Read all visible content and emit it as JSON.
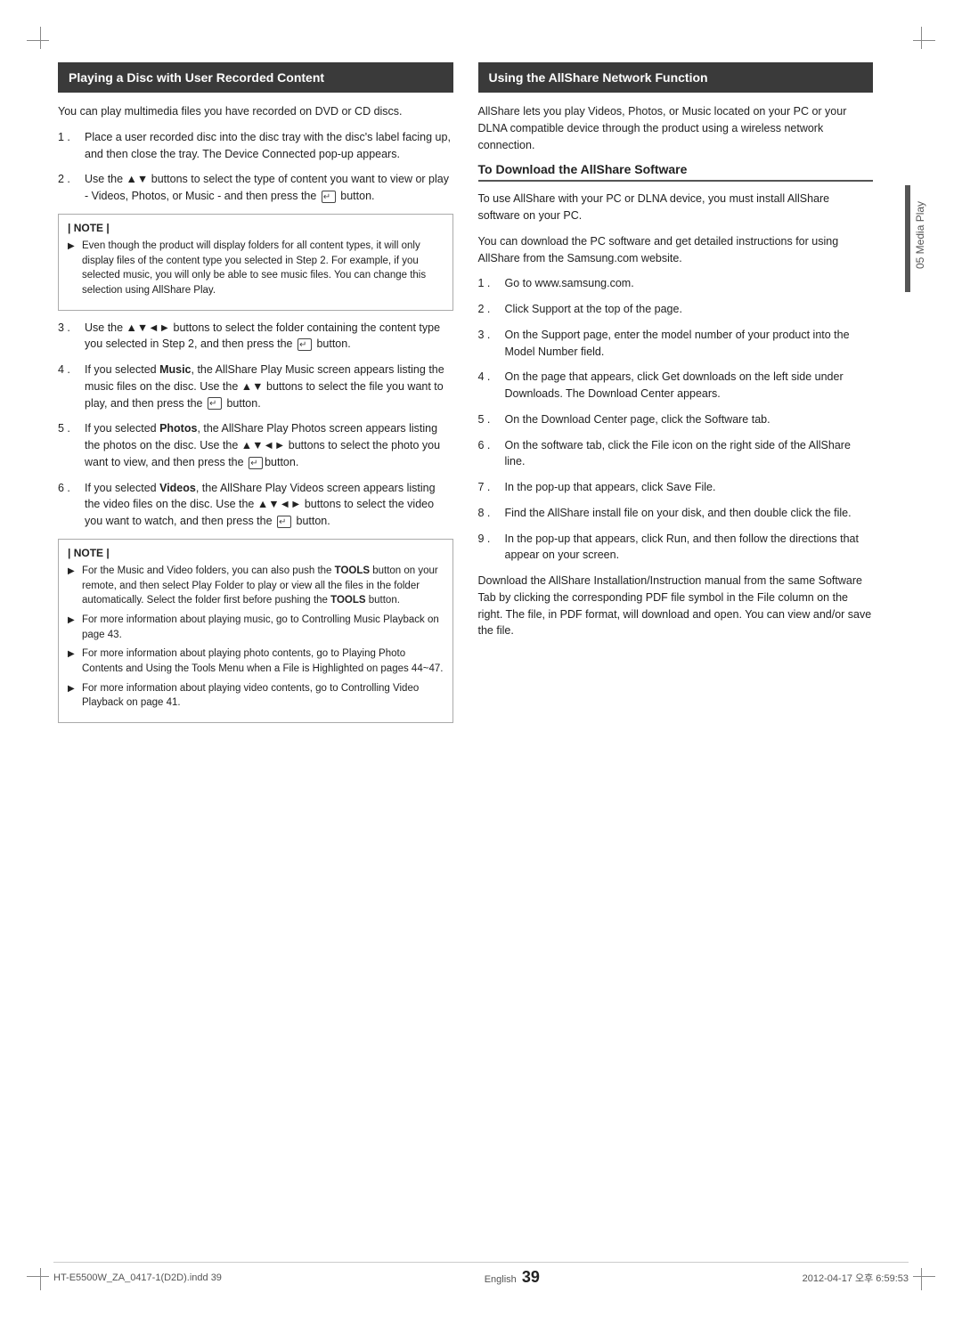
{
  "page": {
    "number": "39",
    "language": "English",
    "footer_left": "HT-E5500W_ZA_0417-1(D2D).indd   39",
    "footer_right": "2012-04-17   오후 6:59:53"
  },
  "side_label": {
    "text": "05 Media Play"
  },
  "left_section": {
    "header": "Playing a Disc with User Recorded Content",
    "intro": "You can play multimedia files you have recorded on DVD or CD discs.",
    "steps": [
      {
        "num": "1 .",
        "text": "Place a user recorded disc into the disc tray with the disc's label facing up, and then close the tray. The Device Connected pop-up appears."
      },
      {
        "num": "2 .",
        "text": "Use the ▲▼ buttons to select the type of content you want to view or play - Videos, Photos, or Music - and then press the  button."
      }
    ],
    "note1_label": "| NOTE |",
    "note1_items": [
      "Even though the product will display folders for all content types, it will only display files of the content type you selected in Step 2. For example, if you selected music, you will only be able to see music files. You can change this selection using AllShare Play."
    ],
    "steps2": [
      {
        "num": "3 .",
        "text": "Use the ▲▼◄► buttons to select the folder containing the content type you selected in Step 2, and then press the  button."
      },
      {
        "num": "4 .",
        "bold_prefix": "Music",
        "text": "If you selected Music, the AllShare Play Music screen appears listing the music files on the disc. Use the ▲▼ buttons to select the file you want to play, and then press the  button."
      },
      {
        "num": "5 .",
        "bold_prefix": "Photos",
        "text": "If you selected Photos, the AllShare Play Photos screen appears listing the photos on the disc. Use the ▲▼◄► buttons to select the photo you want to view, and then press the button."
      },
      {
        "num": "6 .",
        "bold_prefix": "Videos",
        "text": "If you selected Videos, the AllShare Play Videos screen appears listing the video files on the disc. Use the ▲▼◄► buttons to select the video you want to watch, and then press the  button."
      }
    ],
    "note2_label": "| NOTE |",
    "note2_items": [
      "For the Music and Video folders, you can also push the TOOLS button on your remote, and then select Play Folder to play or view all the files in the folder automatically. Select the folder first before pushing the TOOLS button.",
      "For more information about playing music, go to Controlling Music Playback on page 43.",
      "For more information about playing photo contents, go to Playing Photo Contents and Using the Tools Menu when a File is Highlighted on pages 44~47.",
      "For more information about playing video contents, go to Controlling Video Playback on page 41."
    ]
  },
  "right_section": {
    "header": "Using the AllShare Network Function",
    "intro": "AllShare lets you play Videos, Photos, or Music located on your PC or your DLNA compatible device through the product using a wireless network connection.",
    "subheader": "To Download the AllShare Software",
    "sub_intro1": "To use AllShare with your PC or DLNA device, you must install AllShare software on your PC.",
    "sub_intro2": "You can download the PC software and get detailed instructions for using AllShare from the Samsung.com website.",
    "steps": [
      {
        "num": "1 .",
        "text": "Go to www.samsung.com."
      },
      {
        "num": "2 .",
        "text": "Click Support at the top of the page."
      },
      {
        "num": "3 .",
        "text": "On the Support page, enter the model number of your product into the Model Number field."
      },
      {
        "num": "4 .",
        "text": "On the page that appears, click Get downloads on the left side under Downloads. The Download Center appears."
      },
      {
        "num": "5 .",
        "text": "On the Download Center page, click the Software tab."
      },
      {
        "num": "6 .",
        "text": "On the software tab, click the File icon on the right side of the AllShare line."
      },
      {
        "num": "7 .",
        "text": "In the pop-up that appears, click Save File."
      },
      {
        "num": "8 .",
        "text": "Find the AllShare install file on your disk, and then double click the file."
      },
      {
        "num": "9 .",
        "text": "In the pop-up that appears, click Run, and then follow the directions that appear on your screen."
      }
    ],
    "closing": "Download the AllShare Installation/Instruction manual from the same Software Tab by clicking the corresponding PDF file symbol in the File column on the right. The file, in PDF format, will download and open. You can view and/or save the file."
  }
}
